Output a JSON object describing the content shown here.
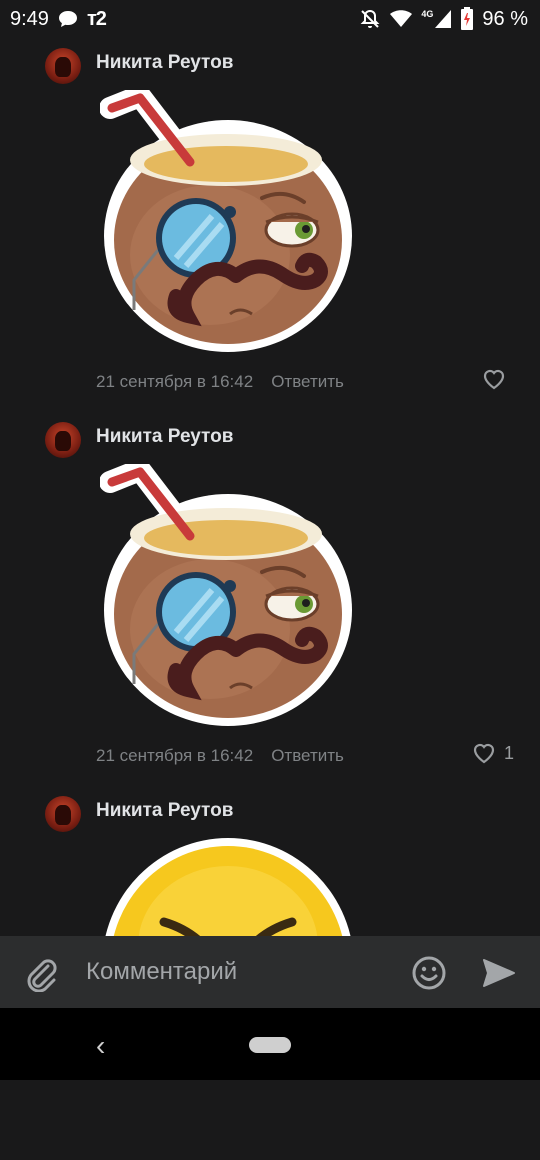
{
  "status_bar": {
    "time": "9:49",
    "carrier": "т2",
    "network": "4G",
    "battery": "96 %"
  },
  "comments": [
    {
      "author": "Никита Реутов",
      "sticker": "coconut-monocle-sticker",
      "date": "21 сентября в 16:42",
      "reply_label": "Ответить",
      "likes": ""
    },
    {
      "author": "Никита Реутов",
      "sticker": "coconut-monocle-sticker",
      "date": "21 сентября в 16:42",
      "reply_label": "Ответить",
      "likes": "1"
    },
    {
      "author": "Никита Реутов",
      "sticker": "angry-emoji-sticker"
    }
  ],
  "input": {
    "placeholder": "Комментарий"
  },
  "icons": {
    "attach": "paperclip-icon",
    "emoji": "smile-icon",
    "send": "send-icon",
    "like": "heart-icon"
  },
  "colors": {
    "background": "#19191a",
    "input_bar": "#2c2d2e",
    "meta_text": "#7f8285"
  }
}
